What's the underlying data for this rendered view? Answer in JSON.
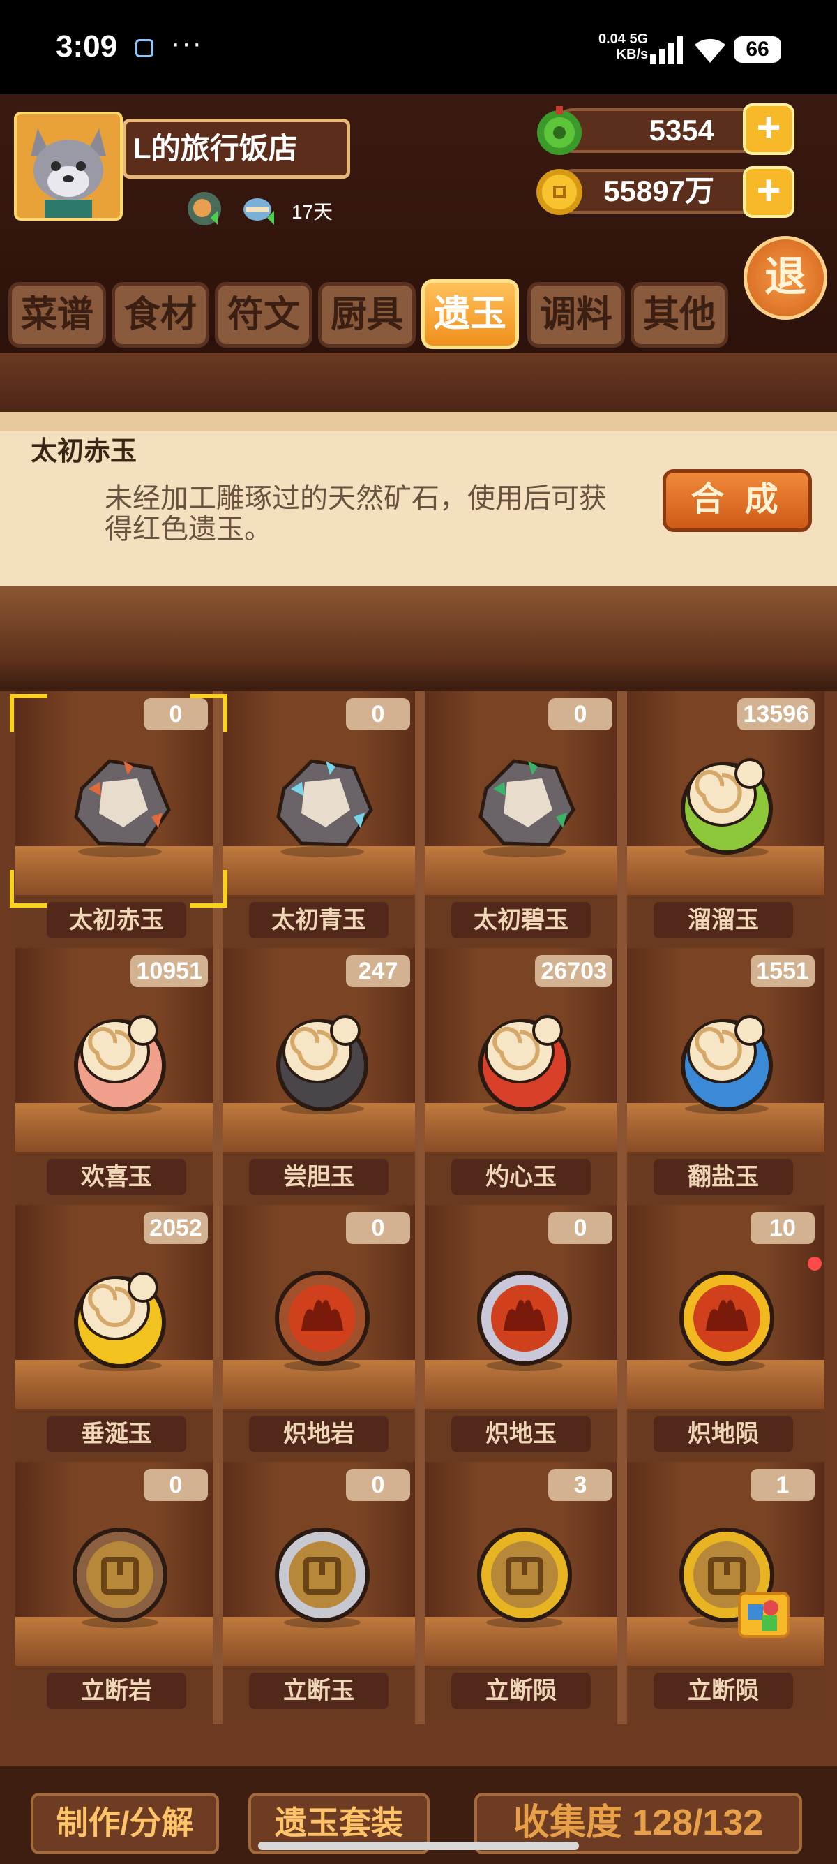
{
  "status_bar": {
    "time": "3:09",
    "more": "···",
    "net_speed": "0.04",
    "net_unit": "KB/s",
    "net_type": "5G",
    "battery": "66"
  },
  "header": {
    "restaurant_name": "L的旅行饭店",
    "days": "17天",
    "jade_amount": "5354",
    "coin_amount": "55897万",
    "exit_label": "退"
  },
  "tabs": [
    {
      "label": "菜谱",
      "active": false
    },
    {
      "label": "食材",
      "active": false
    },
    {
      "label": "符文",
      "active": false
    },
    {
      "label": "厨具",
      "active": false
    },
    {
      "label": "遗玉",
      "active": true
    },
    {
      "label": "调料",
      "active": false
    },
    {
      "label": "其他",
      "active": false
    }
  ],
  "info": {
    "title": "太初赤玉",
    "description": "未经加工雕琢过的天然矿石，使用后可获得红色遗玉。",
    "synth_label": "合 成"
  },
  "items": [
    {
      "name": "太初赤玉",
      "count": "0",
      "icon": "red-raw-ore-icon",
      "color": "#e06a3a"
    },
    {
      "name": "太初青玉",
      "count": "0",
      "icon": "cyan-raw-ore-icon",
      "color": "#7ad4ea"
    },
    {
      "name": "太初碧玉",
      "count": "0",
      "icon": "green-raw-ore-icon",
      "color": "#3cb36a"
    },
    {
      "name": "溜溜玉",
      "count": "13596",
      "icon": "green-jade-swirl-icon",
      "color": "#8cc83a"
    },
    {
      "name": "欢喜玉",
      "count": "10951",
      "icon": "pink-jade-swirl-icon",
      "color": "#f0a08a"
    },
    {
      "name": "尝胆玉",
      "count": "247",
      "icon": "black-jade-swirl-icon",
      "color": "#4a4548"
    },
    {
      "name": "灼心玉",
      "count": "26703",
      "icon": "red-jade-swirl-icon",
      "color": "#d8402a"
    },
    {
      "name": "翻盐玉",
      "count": "1551",
      "icon": "blue-jade-swirl-icon",
      "color": "#3a8ad8"
    },
    {
      "name": "垂涎玉",
      "count": "2052",
      "icon": "yellow-jade-swirl-icon",
      "color": "#f2c21e"
    },
    {
      "name": "炽地岩",
      "count": "0",
      "icon": "fire-rock-medal-icon",
      "color": "#a0502a"
    },
    {
      "name": "炽地玉",
      "count": "0",
      "icon": "fire-jade-medal-icon",
      "color": "#c8c8d8"
    },
    {
      "name": "炽地陨",
      "count": "10",
      "icon": "fire-meteor-medal-icon",
      "color": "#f2b820"
    },
    {
      "name": "立断岩",
      "count": "0",
      "icon": "square-rock-medal-icon",
      "color": "#8a6040"
    },
    {
      "name": "立断玉",
      "count": "0",
      "icon": "square-jade-medal-icon",
      "color": "#c8c8d0"
    },
    {
      "name": "立断陨",
      "count": "3",
      "icon": "square-meteor-medal-icon",
      "color": "#e8b422"
    },
    {
      "name": "立断陨",
      "count": "1",
      "icon": "square-meteor-medal-icon",
      "color": "#e8b422"
    }
  ],
  "footer": {
    "craft_label": "制作/分解",
    "set_label": "遗玉套装",
    "collection_label": "收集度 128/132"
  },
  "colors": {
    "accent": "#f7b928",
    "selection": "#f9d21c",
    "background": "#2a120c"
  }
}
